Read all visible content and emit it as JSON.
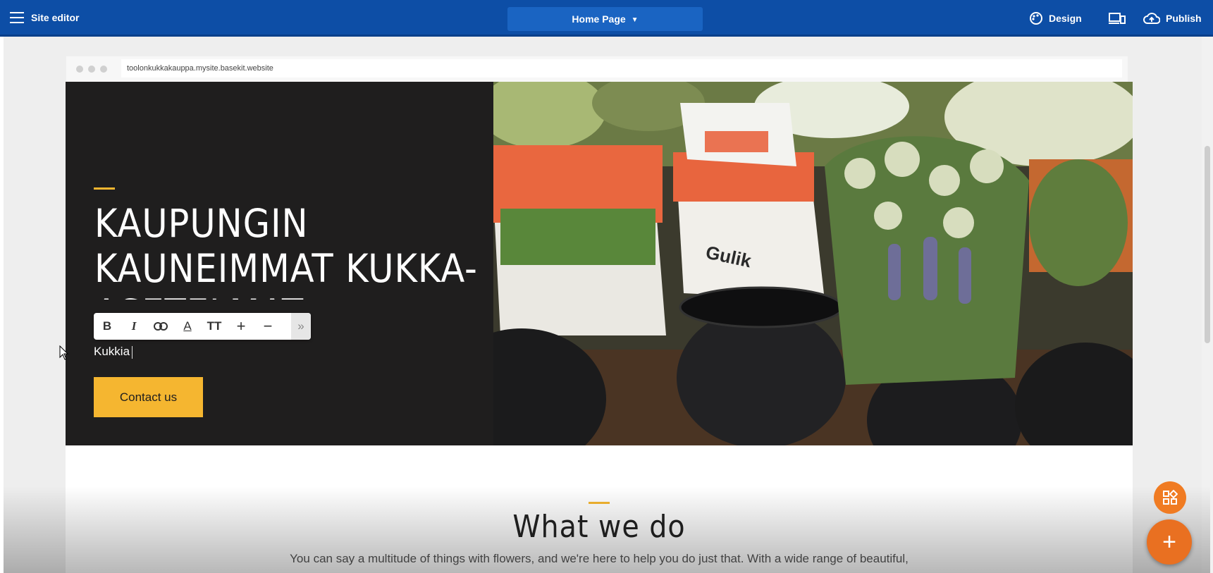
{
  "topbar": {
    "title": "Site editor",
    "page_selector": "Home Page",
    "design_label": "Design",
    "publish_label": "Publish"
  },
  "browser": {
    "url": "toolonkukkakauppa.mysite.basekit.website"
  },
  "hero": {
    "title": "KAUPUNGIN KAUNEIMMAT KUKKA-ASETELMAT",
    "subtitle": "Kukkia",
    "cta_label": "Contact us",
    "image_brand_text": "Gulik"
  },
  "text_toolbar": {
    "bold": "B",
    "italic": "I",
    "text_color": "A",
    "text_size": "TT",
    "increase": "+",
    "decrease": "−",
    "more": "»"
  },
  "section": {
    "heading": "What we do",
    "body": "You can say a multitude of things with flowers, and we're here to help you do just that. With a wide range of beautiful,"
  },
  "colors": {
    "topbar": "#0d4ea6",
    "accent": "#f5b630",
    "hero_bg": "#1f1e1e",
    "fab": "#f07b22"
  }
}
